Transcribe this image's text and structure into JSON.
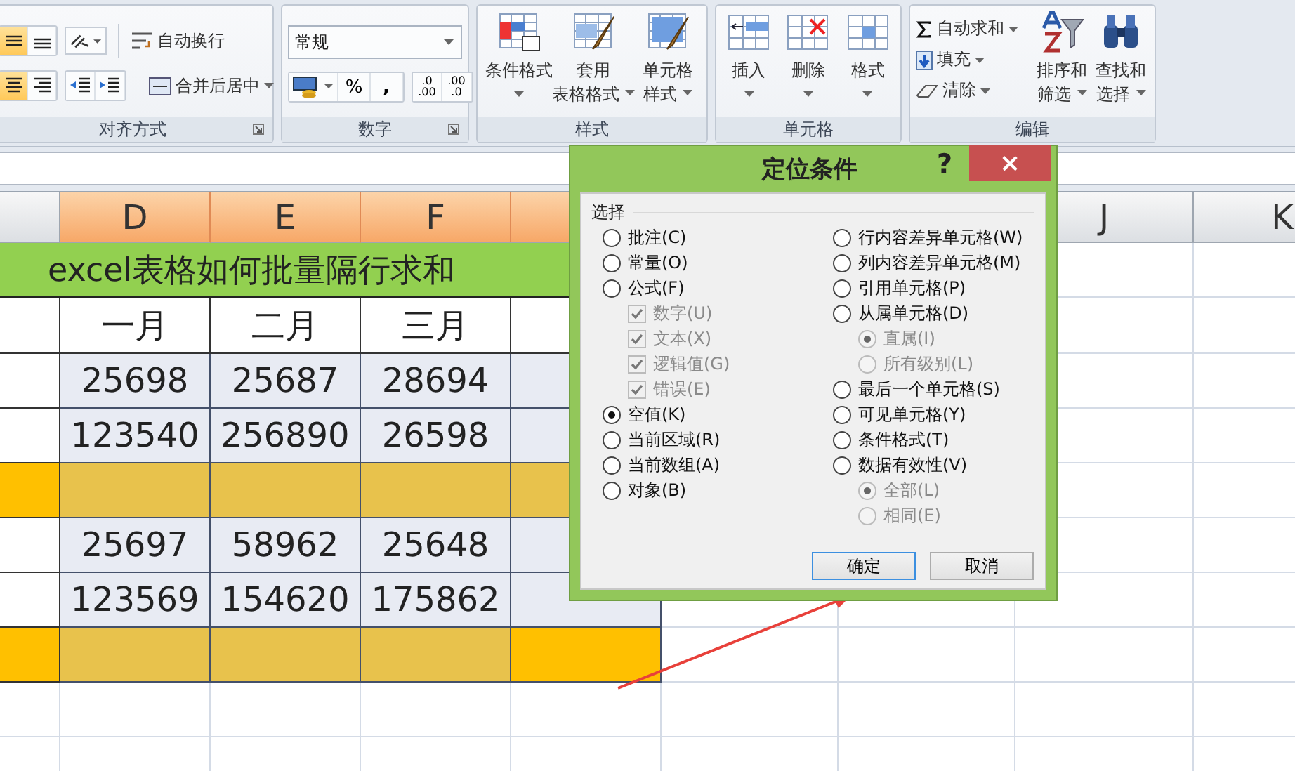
{
  "ribbon": {
    "alignment": {
      "label": "对齐方式",
      "vertical_align": [
        {
          "selected": true
        },
        {
          "selected": false
        }
      ],
      "horizontal_align": [
        {
          "selected": true
        },
        {
          "selected": false
        }
      ],
      "wrap_text": "自动换行",
      "merge_center": "合并后居中"
    },
    "number": {
      "label": "数字",
      "format": "常规",
      "percent": "%",
      "comma": ",",
      "decimals": [
        {
          "top": ".0",
          "bottom": ".00"
        },
        {
          "top": ".00",
          "bottom": ".0"
        }
      ]
    },
    "styles": {
      "label": "样式",
      "buttons": [
        {
          "lines": [
            "条件格式"
          ]
        },
        {
          "lines": [
            "套用",
            "表格格式"
          ]
        },
        {
          "lines": [
            "单元格",
            "样式"
          ]
        }
      ]
    },
    "cells": {
      "label": "单元格",
      "buttons": [
        {
          "lines": [
            "插入"
          ]
        },
        {
          "lines": [
            "删除"
          ]
        },
        {
          "lines": [
            "格式"
          ]
        }
      ]
    },
    "editing": {
      "label": "编辑",
      "small_buttons": [
        {
          "label": "自动求和"
        },
        {
          "label": "填充"
        },
        {
          "label": "清除"
        }
      ],
      "large_buttons": [
        {
          "lines": [
            "排序和",
            "筛选"
          ]
        },
        {
          "lines": [
            "查找和",
            "选择"
          ]
        }
      ]
    }
  },
  "columns": [
    {
      "label": "D",
      "selected": true
    },
    {
      "label": "E",
      "selected": true
    },
    {
      "label": "F",
      "selected": true
    },
    {
      "selected": true
    },
    {
      "label": "J",
      "selected": false
    },
    {
      "label": "K",
      "selected": false
    }
  ],
  "sheet": {
    "title": "excel表格如何批量隔行求和",
    "header": [
      "一月",
      "二月",
      "三月"
    ],
    "rows": [
      {
        "kind": "data",
        "selected": true,
        "active": false,
        "values": [
          "25698",
          "25687",
          "28694"
        ]
      },
      {
        "kind": "data",
        "selected": true,
        "active": false,
        "values": [
          "123540",
          "256890",
          "26598"
        ]
      },
      {
        "kind": "subtotal",
        "selected": true,
        "active": false
      },
      {
        "kind": "data",
        "selected": true,
        "active": false,
        "values": [
          "25697",
          "58962",
          "25648"
        ]
      },
      {
        "kind": "data",
        "selected": true,
        "active": false,
        "values": [
          "123569",
          "154620",
          "175862"
        ]
      },
      {
        "kind": "subtotal",
        "selected": true,
        "active": true
      }
    ]
  },
  "dialog": {
    "title": "定位条件",
    "help": "?",
    "close": "×",
    "section": "选择",
    "columns": [
      [
        {
          "kind": "radio",
          "label": "批注(C)",
          "selected": false,
          "disabled": false
        },
        {
          "kind": "radio",
          "label": "常量(O)",
          "selected": false,
          "disabled": false
        },
        {
          "kind": "radio",
          "label": "公式(F)",
          "selected": false,
          "disabled": false,
          "children": [
            {
              "kind": "check",
              "label": "数字(U)",
              "checked": true,
              "disabled": true
            },
            {
              "kind": "check",
              "label": "文本(X)",
              "checked": true,
              "disabled": true
            },
            {
              "kind": "check",
              "label": "逻辑值(G)",
              "checked": true,
              "disabled": true
            },
            {
              "kind": "check",
              "label": "错误(E)",
              "checked": true,
              "disabled": true
            }
          ]
        },
        {
          "kind": "radio",
          "label": "空值(K)",
          "selected": true,
          "disabled": false
        },
        {
          "kind": "radio",
          "label": "当前区域(R)",
          "selected": false,
          "disabled": false
        },
        {
          "kind": "radio",
          "label": "当前数组(A)",
          "selected": false,
          "disabled": false
        },
        {
          "kind": "radio",
          "label": "对象(B)",
          "selected": false,
          "disabled": false
        }
      ],
      [
        {
          "kind": "radio",
          "label": "行内容差异单元格(W)",
          "selected": false,
          "disabled": false
        },
        {
          "kind": "radio",
          "label": "列内容差异单元格(M)",
          "selected": false,
          "disabled": false
        },
        {
          "kind": "radio",
          "label": "引用单元格(P)",
          "selected": false,
          "disabled": false
        },
        {
          "kind": "radio",
          "label": "从属单元格(D)",
          "selected": false,
          "disabled": false,
          "children": [
            {
              "kind": "radio",
              "label": "直属(I)",
              "selected": true,
              "disabled": true
            },
            {
              "kind": "radio",
              "label": "所有级别(L)",
              "selected": false,
              "disabled": true
            }
          ]
        },
        {
          "kind": "radio",
          "label": "最后一个单元格(S)",
          "selected": false,
          "disabled": false
        },
        {
          "kind": "radio",
          "label": "可见单元格(Y)",
          "selected": false,
          "disabled": false
        },
        {
          "kind": "radio",
          "label": "条件格式(T)",
          "selected": false,
          "disabled": false
        },
        {
          "kind": "radio",
          "label": "数据有效性(V)",
          "selected": false,
          "disabled": false,
          "children": [
            {
              "kind": "radio",
              "label": "全部(L)",
              "selected": true,
              "disabled": true
            },
            {
              "kind": "radio",
              "label": "相同(E)",
              "selected": false,
              "disabled": true
            }
          ]
        }
      ]
    ],
    "buttons": [
      {
        "label": "确定",
        "default": true
      },
      {
        "label": "取消",
        "default": false
      }
    ]
  }
}
